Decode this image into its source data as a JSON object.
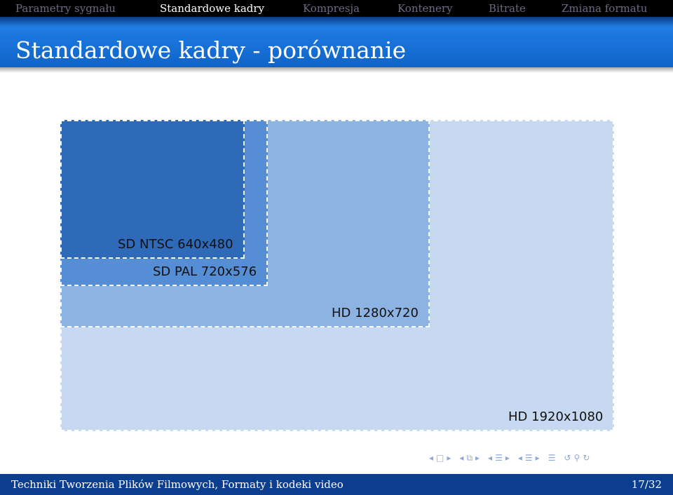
{
  "nav": {
    "items": [
      {
        "label": "Parametry sygnału",
        "active": false
      },
      {
        "label": "Standardowe kadry",
        "active": true
      },
      {
        "label": "Kompresja",
        "active": false
      },
      {
        "label": "Kontenery",
        "active": false
      },
      {
        "label": "Bitrate",
        "active": false
      },
      {
        "label": "Zmiana formatu",
        "active": false
      }
    ]
  },
  "slide": {
    "title": "Standardowe kadry - porównanie"
  },
  "frames": [
    {
      "label": "HD 1920x1080",
      "width": 1920,
      "height": 1080,
      "color": "#c6d9f0"
    },
    {
      "label": "HD 1280x720",
      "width": 1280,
      "height": 720,
      "color": "#8db3e2"
    },
    {
      "label": "SD PAL 720x576",
      "width": 720,
      "height": 576,
      "color": "#558ed5"
    },
    {
      "label": "SD NTSC 640x480",
      "width": 640,
      "height": 480,
      "color": "#2f6ab8"
    }
  ],
  "beamer_nav": {
    "symbols": [
      "◂",
      "□",
      "▸",
      "◂",
      "⧉",
      "▸",
      "◂",
      "☰",
      "▸",
      "◂",
      "☰",
      "▸",
      "☰",
      "↺",
      "⚲",
      "↻"
    ]
  },
  "footer": {
    "text": "Techniki Tworzenia Plików Filmowych, Formaty i kodeki video",
    "page": "17/32"
  }
}
